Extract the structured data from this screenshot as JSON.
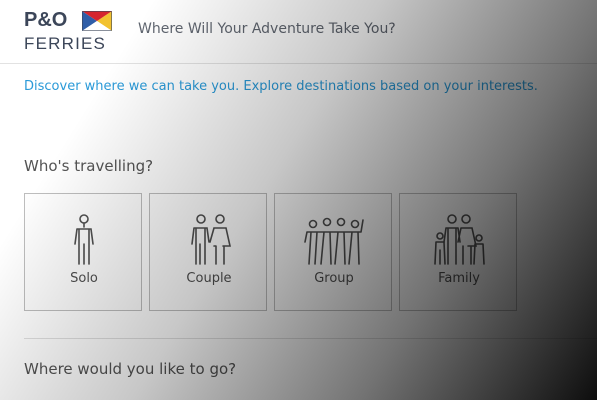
{
  "header": {
    "logo_line1": "P&O",
    "logo_line2": "FERRIES",
    "title": "Where Will Your Adventure Take You?"
  },
  "intro": "Discover where we can take you. Explore destinations based on your interests.",
  "travellers": {
    "heading": "Who's travelling?",
    "options": [
      {
        "label": "Solo",
        "icon": "solo-person-icon"
      },
      {
        "label": "Couple",
        "icon": "couple-icon"
      },
      {
        "label": "Group",
        "icon": "group-icon"
      },
      {
        "label": "Family",
        "icon": "family-icon"
      }
    ]
  },
  "destination": {
    "heading": "Where would you like to go?"
  },
  "colors": {
    "brand_navy": "#3c4659",
    "link_blue": "#2a9ad8",
    "flag_red": "#d6252e",
    "flag_blue": "#2f5ea8",
    "flag_yellow": "#f2c230"
  }
}
